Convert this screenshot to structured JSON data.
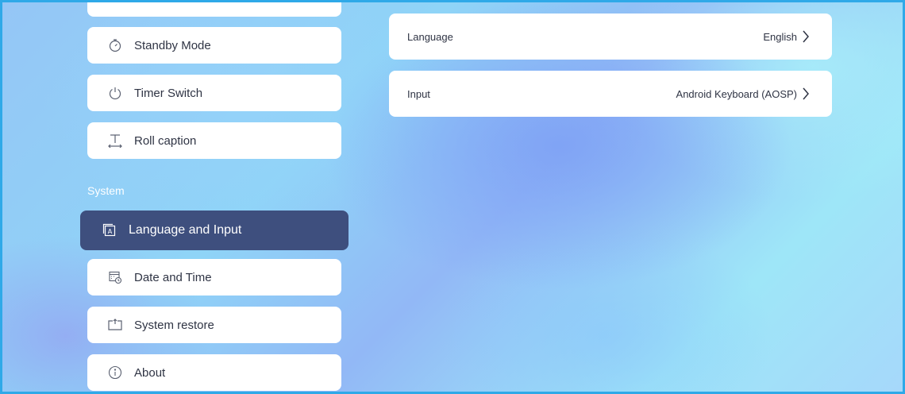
{
  "sidebar": {
    "items": [
      {
        "label": "Standby Mode",
        "icon": "stopwatch-icon"
      },
      {
        "label": "Timer Switch",
        "icon": "power-icon"
      },
      {
        "label": "Roll caption",
        "icon": "text-scroll-icon"
      }
    ],
    "section_title": "System",
    "system_items": [
      {
        "label": "Language and Input",
        "icon": "language-icon",
        "active": true
      },
      {
        "label": "Date and Time",
        "icon": "calendar-clock-icon"
      },
      {
        "label": "System restore",
        "icon": "restore-icon"
      },
      {
        "label": "About",
        "icon": "info-icon"
      }
    ]
  },
  "main": {
    "rows": [
      {
        "name": "Language",
        "value": "English"
      },
      {
        "name": "Input",
        "value": "Android Keyboard (AOSP)"
      }
    ]
  },
  "colors": {
    "frame_border": "#2fa9e8",
    "active_item_bg": "#3e4f7e",
    "card_bg": "#ffffff"
  }
}
